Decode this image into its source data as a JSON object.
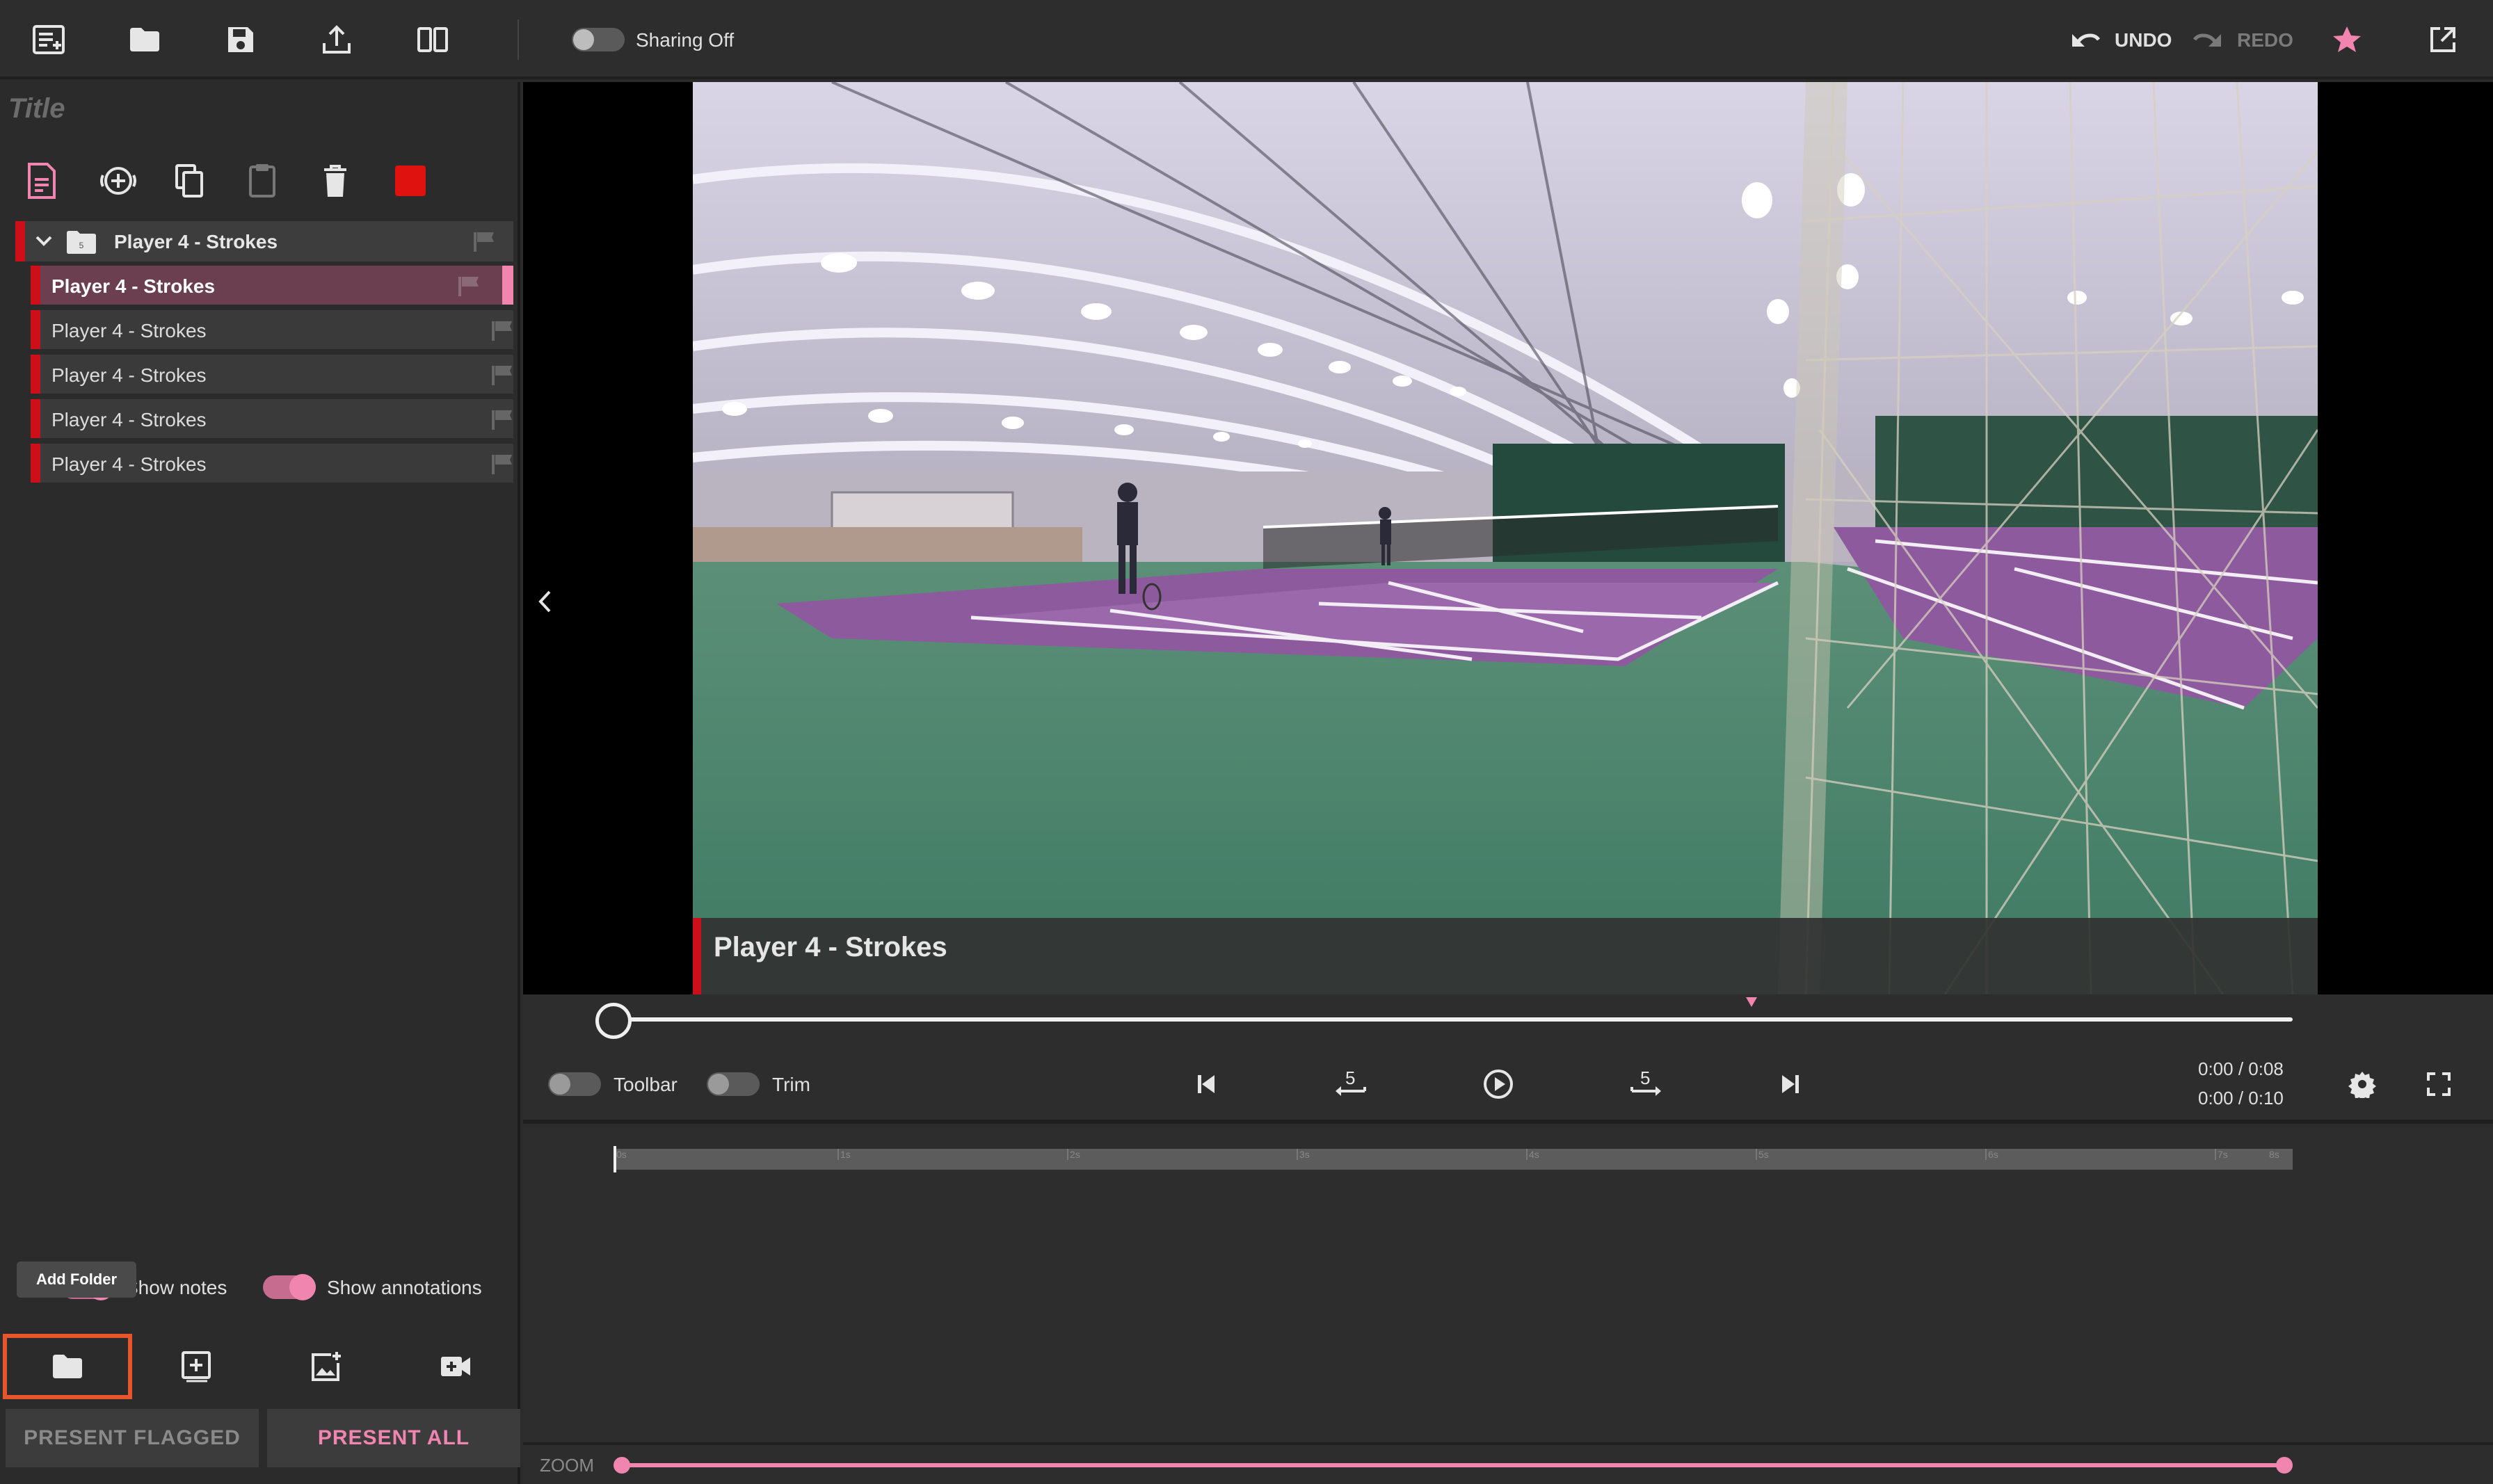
{
  "toolbar": {
    "sharing_label": "Sharing Off",
    "undo_label": "UNDO",
    "redo_label": "REDO"
  },
  "sidebar": {
    "title_placeholder": "Title",
    "folder_name": "Player 4 - Strokes",
    "items": [
      {
        "label": "Player 4 - Strokes"
      },
      {
        "label": "Player 4 - Strokes"
      },
      {
        "label": "Player 4 - Strokes"
      },
      {
        "label": "Player 4 - Strokes"
      },
      {
        "label": "Player 4 - Strokes"
      }
    ],
    "show_notes_label": "Show notes",
    "show_annotations_label": "Show annotations",
    "tooltip": "Add Folder",
    "present_flagged": "PRESENT FLAGGED",
    "present_all": "PRESENT ALL"
  },
  "player": {
    "caption": "Player 4 - Strokes",
    "toolbar_label": "Toolbar",
    "trim_label": "Trim",
    "skip_seconds": "5",
    "time_clip": "0:00 / 0:08",
    "time_total": "0:00 / 0:10",
    "progress": 0.0,
    "zoom_label": "ZOOM"
  },
  "timeline": {
    "ticks": [
      "0s",
      "1s",
      "2s",
      "3s",
      "4s",
      "5s",
      "6s",
      "7s",
      "8s"
    ]
  },
  "colors": {
    "accent_pink": "#f085b0",
    "flag_red": "#cc0f18",
    "highlight_orange": "#e8542c"
  }
}
